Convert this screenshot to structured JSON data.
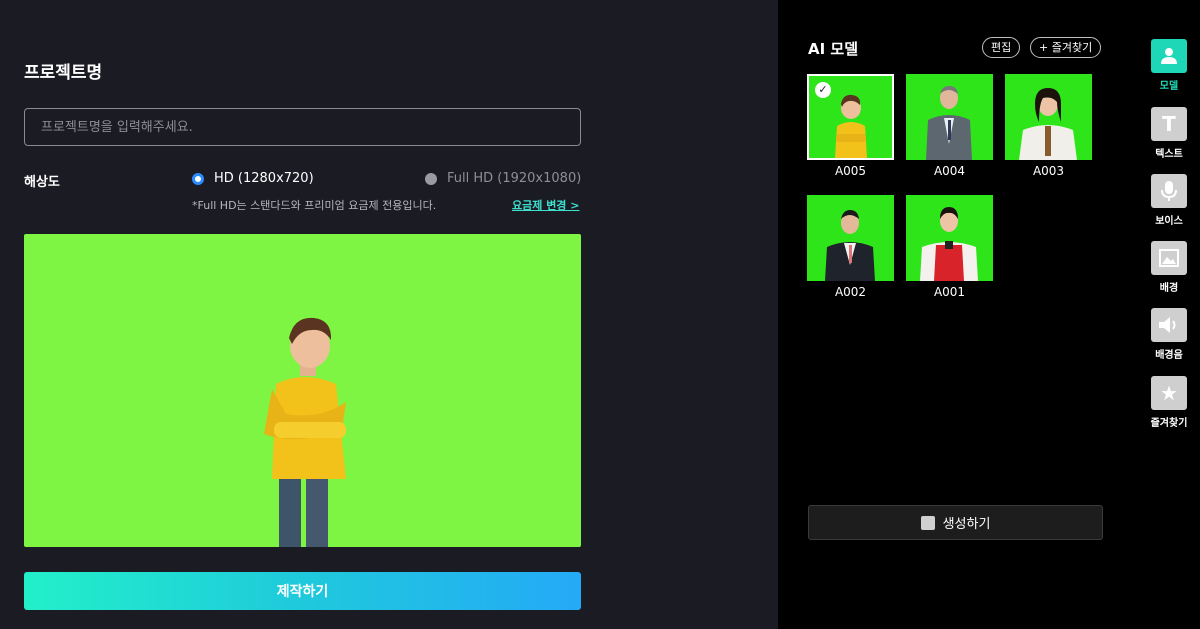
{
  "editor": {
    "title": "프로젝트명",
    "input_placeholder": "프로젝트명을 입력해주세요.",
    "resolution_label": "해상도",
    "options": [
      {
        "label": "HD (1280x720)",
        "selected": true
      },
      {
        "label": "Full HD (1920x1080)",
        "selected": false
      }
    ],
    "note": "*Full HD는 스탠다드와 프리미엄 요금제 전용입니다.",
    "plan_link": "요금제 변경 >",
    "make_button": "제작하기"
  },
  "models_panel": {
    "title": "AI 모델",
    "edit_button": "편집",
    "favorite_button": "+ 즐겨찾기",
    "models": [
      {
        "name": "A005",
        "selected": true
      },
      {
        "name": "A004",
        "selected": false
      },
      {
        "name": "A003",
        "selected": false
      },
      {
        "name": "A002",
        "selected": false
      },
      {
        "name": "A001",
        "selected": false
      }
    ],
    "generate_button": "생성하기"
  },
  "sidebar": {
    "items": [
      {
        "label": "모델",
        "icon": "person-icon",
        "active": true
      },
      {
        "label": "텍스트",
        "icon": "text-icon",
        "active": false
      },
      {
        "label": "보이스",
        "icon": "microphone-icon",
        "active": false
      },
      {
        "label": "배경",
        "icon": "image-icon",
        "active": false
      },
      {
        "label": "배경음",
        "icon": "speaker-icon",
        "active": false
      },
      {
        "label": "즐겨찾기",
        "icon": "star-icon",
        "active": false
      }
    ]
  },
  "colors": {
    "accent": "#1ed7b6",
    "chroma_green": "#7ef542",
    "left_bg": "#1b1b24"
  }
}
